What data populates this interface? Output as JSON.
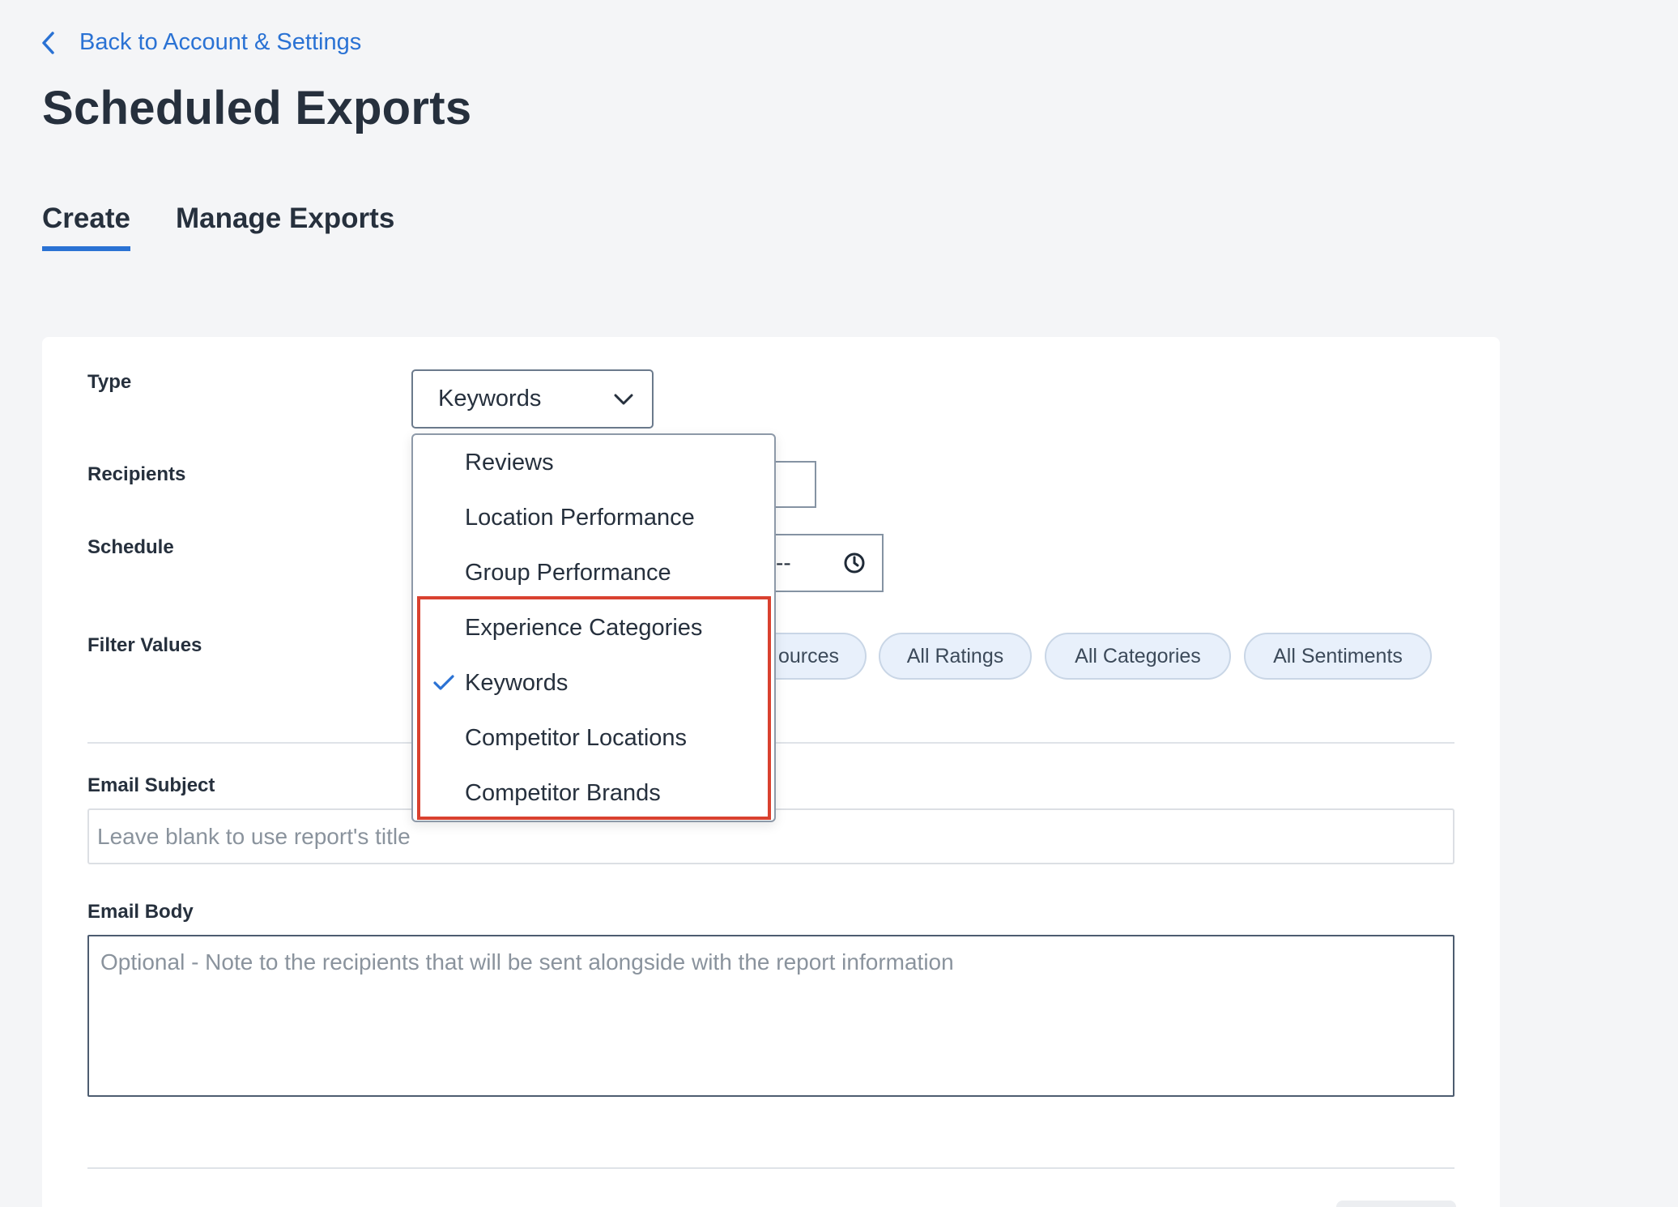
{
  "nav": {
    "back_label": "Back to Account & Settings"
  },
  "page": {
    "title": "Scheduled Exports"
  },
  "tabs": [
    {
      "label": "Create",
      "active": true
    },
    {
      "label": "Manage Exports",
      "active": false
    }
  ],
  "form": {
    "type_label": "Type",
    "type_value": "Keywords",
    "recipients_label": "Recipients",
    "schedule_label": "Schedule",
    "schedule_time_value": "--",
    "filter_label": "Filter Values",
    "filters": [
      {
        "label": "ources",
        "note": "partially hidden behind dropdown"
      },
      {
        "label": "All Ratings"
      },
      {
        "label": "All Categories"
      },
      {
        "label": "All Sentiments"
      }
    ],
    "email_subject_label": "Email Subject",
    "email_subject_placeholder": "Leave blank to use report's title",
    "email_body_label": "Email Body",
    "email_body_placeholder": "Optional - Note to the recipients that will be sent alongside with the report information"
  },
  "dropdown": {
    "options": [
      {
        "label": "Reviews",
        "selected": false
      },
      {
        "label": "Location Performance",
        "selected": false
      },
      {
        "label": "Group Performance",
        "selected": false
      },
      {
        "label": "Experience Categories",
        "selected": false
      },
      {
        "label": "Keywords",
        "selected": true
      },
      {
        "label": "Competitor Locations",
        "selected": false
      },
      {
        "label": "Competitor Brands",
        "selected": false
      }
    ],
    "highlight_color": "#d9412f"
  },
  "icons": {
    "back": "chevron-left-icon",
    "select": "chevron-down-icon",
    "time": "clock-icon",
    "selected_option": "checkmark-icon"
  },
  "colors": {
    "accent": "#2a72d4",
    "background": "#f4f5f7",
    "chip_bg": "#e8f0fb"
  }
}
